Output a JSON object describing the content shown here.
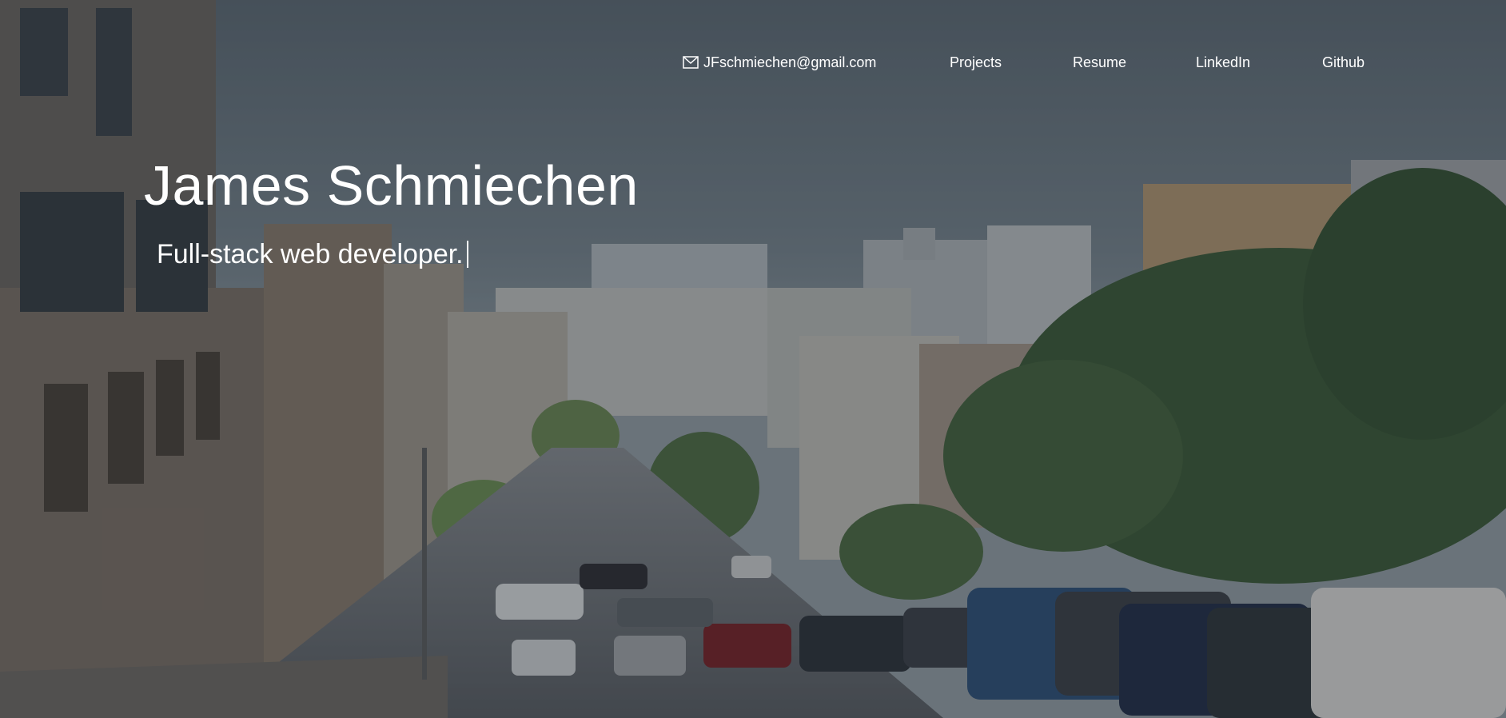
{
  "nav": {
    "email": "JFschmiechen@gmail.com",
    "email_icon": "mail-icon",
    "projects": "Projects",
    "resume": "Resume",
    "linkedin": "LinkedIn",
    "github": "Github"
  },
  "hero": {
    "name": "James Schmiechen",
    "tagline": "Full-stack web developer."
  },
  "colors": {
    "text": "#ffffff",
    "sky": "#5b6670",
    "overlay": "#1e242c"
  }
}
